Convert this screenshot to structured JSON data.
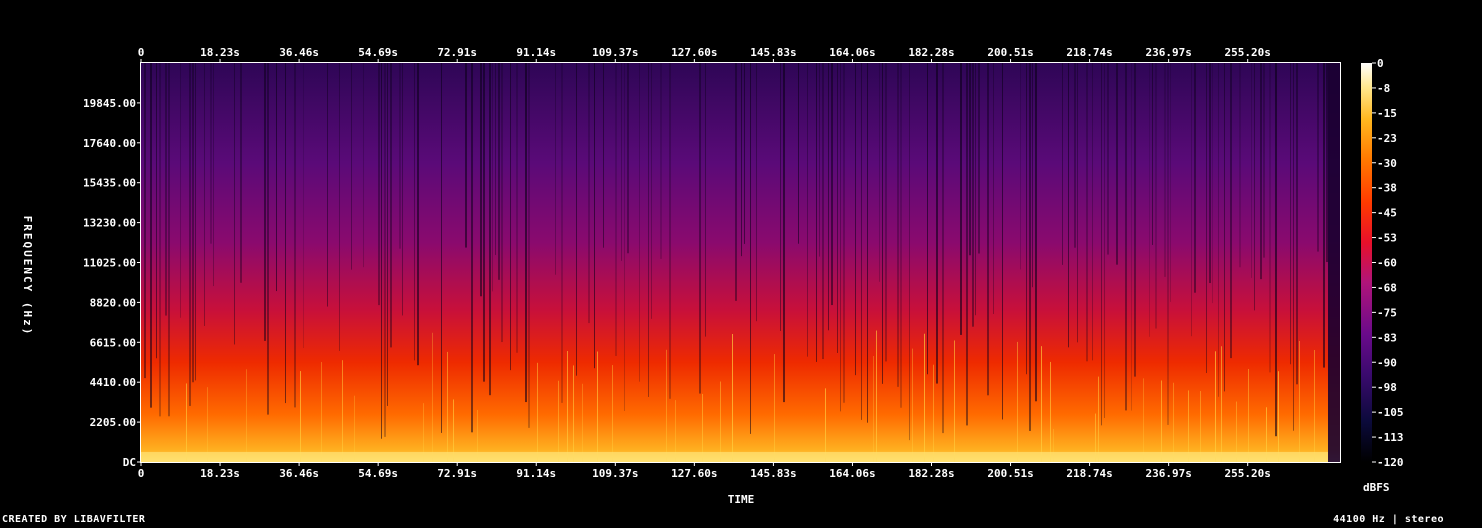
{
  "chart_data": {
    "type": "heatmap",
    "title": "",
    "xlabel": "TIME",
    "ylabel": "FREQUENCY (Hz)",
    "x_ticks": [
      "0",
      "18.23s",
      "36.46s",
      "54.69s",
      "72.91s",
      "91.14s",
      "109.37s",
      "127.60s",
      "145.83s",
      "164.06s",
      "182.28s",
      "200.51s",
      "218.74s",
      "236.97s",
      "255.20s"
    ],
    "y_ticks": [
      "DC",
      "2205.00",
      "4410.00",
      "6615.00",
      "8820.00",
      "11025.00",
      "13230.00",
      "15435.00",
      "17640.00",
      "19845.00"
    ],
    "colorbar_ticks": [
      "0",
      "-8",
      "-15",
      "-23",
      "-30",
      "-38",
      "-45",
      "-53",
      "-60",
      "-68",
      "-75",
      "-83",
      "-90",
      "-98",
      "-105",
      "-113",
      "-120"
    ],
    "colorbar_unit": "dBFS",
    "xlim": [
      0,
      265
    ],
    "ylim": [
      0,
      22050
    ],
    "zlim": [
      -120,
      0
    ],
    "colormap": "intensity (black-purple-red-orange-yellow-white)"
  },
  "footer": {
    "credit": "CREATED BY LIBAVFILTER",
    "info": "44100 Hz | stereo"
  }
}
